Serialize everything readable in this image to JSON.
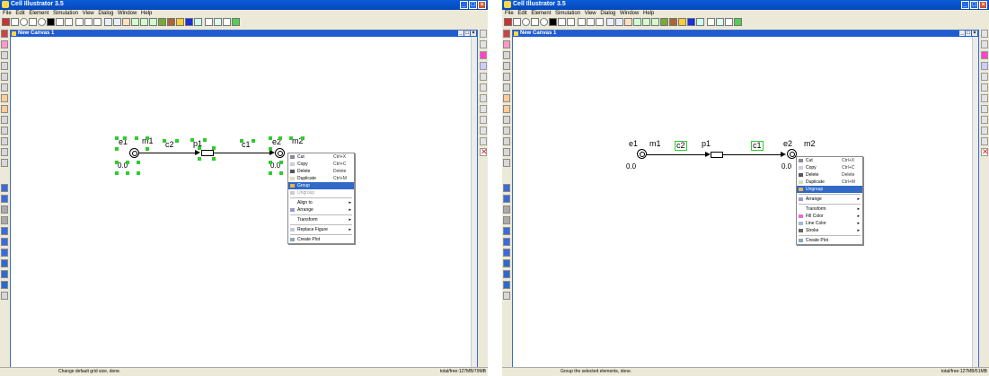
{
  "app_title": "Cell Illustrator 3.5",
  "menu": [
    "File",
    "Edit",
    "Element",
    "Simulation",
    "View",
    "Dialog",
    "Window",
    "Help"
  ],
  "canvas_title": "New Canvas 1",
  "canvas_buttons": [
    "_",
    "□",
    "×"
  ],
  "labels": {
    "e1": "e1",
    "m1": "m1",
    "c2": "c2",
    "p1": "p1",
    "c1": "c1",
    "e2": "e2",
    "m2": "m2",
    "zero": "0.0"
  },
  "left_window": {
    "menu": {
      "cut": "Cut",
      "cut_sc": "Ctrl+X",
      "copy": "Copy",
      "copy_sc": "Ctrl+C",
      "delete": "Delete",
      "delete_sc": "Delete",
      "duplicate": "Duplicate",
      "duplicate_sc": "Ctrl+M",
      "group": "Group",
      "ungroup": "Ungroup",
      "align": "Align to",
      "arrange": "Arrange",
      "transform": "Transform",
      "replace": "Replace Figure",
      "plot": "Create Plot"
    },
    "status": "Change default grid size, done.",
    "memory": "total/free:127MB/79MB"
  },
  "right_window": {
    "menu": {
      "cut": "Cut",
      "cut_sc": "Ctrl+X",
      "copy": "Copy",
      "copy_sc": "Ctrl+C",
      "delete": "Delete",
      "delete_sc": "Delete",
      "duplicate": "Duplicate",
      "duplicate_sc": "Ctrl+M",
      "ungroup": "Ungroup",
      "arrange": "Arrange",
      "transform": "Transform",
      "fill": "Fill Color",
      "line": "Line Color",
      "stroke": "Stroke",
      "plot": "Create Plot"
    },
    "status": "Group the selected elements, done.",
    "memory": "total/free:127MB/51MB"
  },
  "colors": {
    "title_blue": "#0a5bd8",
    "highlight": "#3169c6",
    "selection_green": "#2ecc2e"
  }
}
